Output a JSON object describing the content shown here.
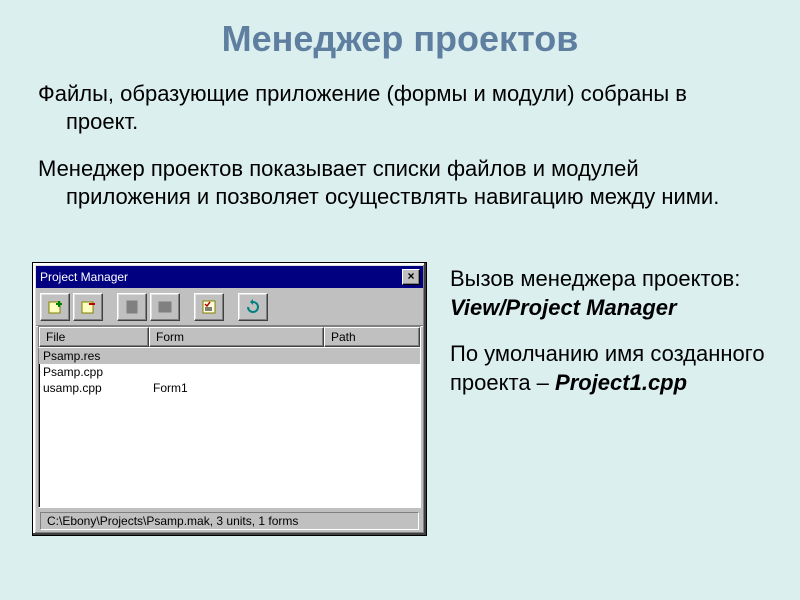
{
  "title": "Менеджер проектов",
  "para1": "Файлы, образующие приложение (формы и модули) собраны в проект.",
  "para2": "Менеджер проектов показывает списки файлов и модулей приложения и позволяет осуществлять навигацию между ними.",
  "side": {
    "call_label": "Вызов менеджера проектов:",
    "call_path": "View/Project Manager",
    "default_label": "По умолчанию имя созданного проекта – ",
    "default_name": "Project1.cpp"
  },
  "window": {
    "title": "Project Manager",
    "close": "×",
    "columns": {
      "file": "File",
      "form": "Form",
      "path": "Path"
    },
    "rows": [
      {
        "file": "Psamp.res",
        "form": "",
        "path": "",
        "selected": true
      },
      {
        "file": "Psamp.cpp",
        "form": "",
        "path": "",
        "selected": false
      },
      {
        "file": "usamp.cpp",
        "form": "Form1",
        "path": "",
        "selected": false
      }
    ],
    "status": "C:\\Ebony\\Projects\\Psamp.mak, 3 units, 1 forms"
  }
}
